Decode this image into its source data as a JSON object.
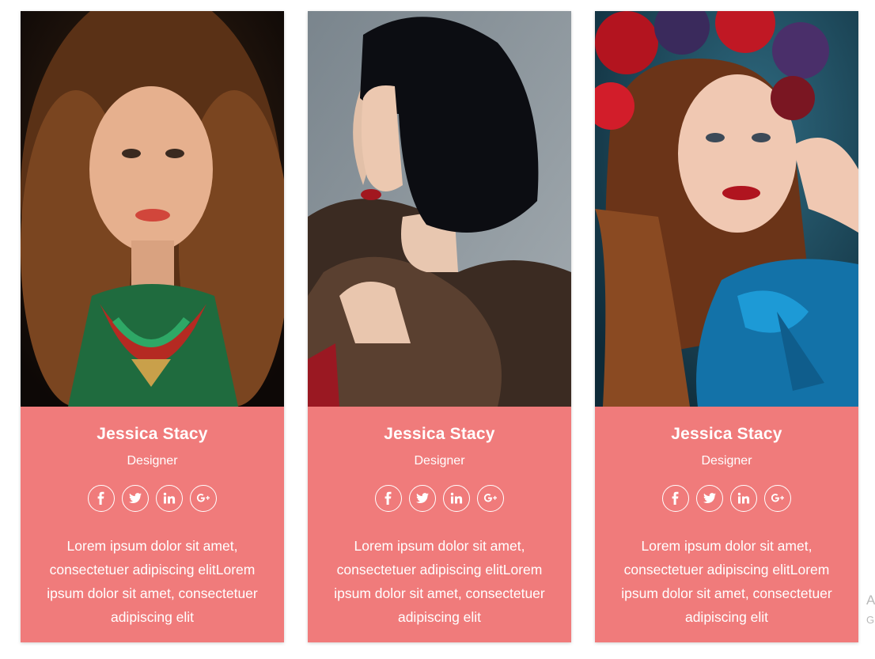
{
  "cards": [
    {
      "name": "Jessica Stacy",
      "role": "Designer",
      "bio": "Lorem ipsum dolor sit amet, consectetuer adipiscing elitLorem ipsum dolor sit amet, consectetuer adipiscing elit",
      "photo_icon": "portrait-curly-hair-photo"
    },
    {
      "name": "Jessica Stacy",
      "role": "Designer",
      "bio": "Lorem ipsum dolor sit amet, consectetuer adipiscing elitLorem ipsum dolor sit amet, consectetuer adipiscing elit",
      "photo_icon": "portrait-black-bob-photo"
    },
    {
      "name": "Jessica Stacy",
      "role": "Designer",
      "bio": "Lorem ipsum dolor sit amet, consectetuer adipiscing elitLorem ipsum dolor sit amet, consectetuer adipiscing elit",
      "photo_icon": "portrait-flower-crown-photo"
    }
  ],
  "social_icons": [
    "facebook-icon",
    "twitter-icon",
    "linkedin-icon",
    "google-plus-icon"
  ],
  "edge": {
    "char1": "A",
    "char2": "G"
  },
  "colors": {
    "card_background": "#f07b7b",
    "text": "#ffffff"
  }
}
